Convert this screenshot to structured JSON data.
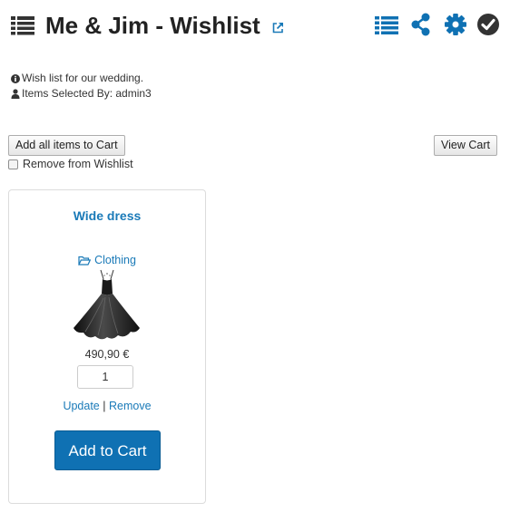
{
  "header": {
    "title": "Me & Jim - Wishlist",
    "icons": {
      "main": "list-icon",
      "external": "external-link-icon",
      "toolbar": [
        "list-icon",
        "share-icon",
        "gear-icon",
        "check-circle-icon"
      ]
    },
    "colors": {
      "accent": "#0f71b3",
      "title": "#222222",
      "check": "#333333"
    }
  },
  "info": {
    "description": "Wish list for our wedding.",
    "selected_by": "Items Selected By: admin3"
  },
  "actions": {
    "add_all_label": "Add all items to Cart",
    "view_cart_label": "View Cart",
    "remove_from_wishlist_label": "Remove from Wishlist",
    "remove_from_wishlist_checked": false
  },
  "product": {
    "name": "Wide dress",
    "category": "Clothing",
    "price": "490,90 €",
    "quantity": "1",
    "update_label": "Update",
    "separator": "|",
    "remove_label": "Remove",
    "add_to_cart_label": "Add to Cart"
  }
}
